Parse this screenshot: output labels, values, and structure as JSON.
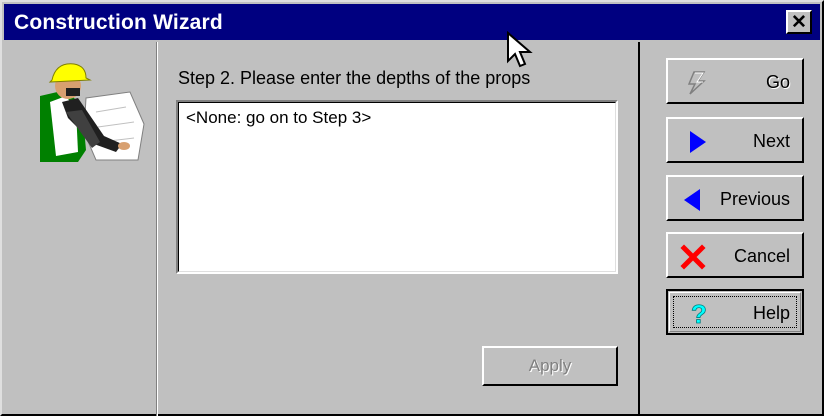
{
  "window": {
    "title": "Construction Wizard",
    "close_label": "✕"
  },
  "main": {
    "step_label": "Step 2. Please enter the depths of the props",
    "textarea_value": "<None: go on to Step 3>",
    "apply_label": "Apply"
  },
  "buttons": {
    "go": {
      "label": "Go",
      "icon": "lightning-icon",
      "enabled": false
    },
    "next": {
      "label": "Next",
      "icon": "arrow-right-icon",
      "color": "#0000ff"
    },
    "previous": {
      "label": "Previous",
      "icon": "arrow-left-icon",
      "color": "#0000ff"
    },
    "cancel": {
      "label": "Cancel",
      "icon": "red-x-icon",
      "color": "#ff0000"
    },
    "help": {
      "label": "Help",
      "icon": "question-mark-icon",
      "color": "#00ffff"
    }
  },
  "colors": {
    "title_bar": "#000080",
    "face": "#c0c0c0",
    "helmet": "#ffff00",
    "vest": "#008000"
  }
}
